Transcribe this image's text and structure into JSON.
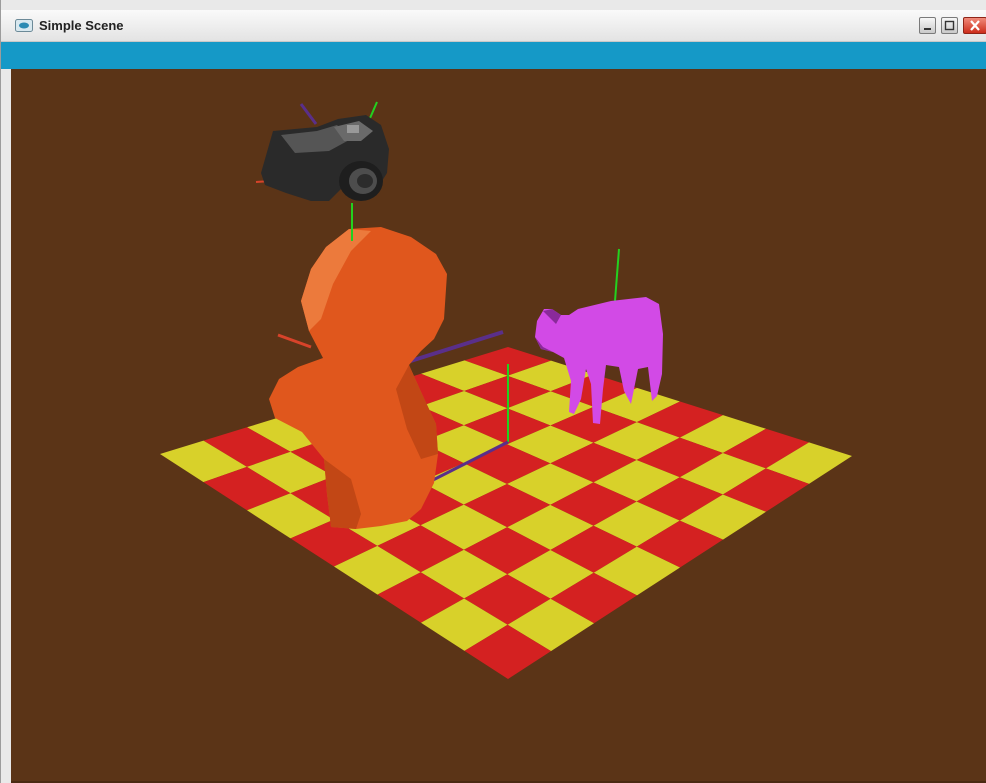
{
  "window": {
    "title": "Simple Scene",
    "minimize_icon": "minimize-icon",
    "maximize_icon": "maximize-icon",
    "close_icon": "close-icon"
  },
  "scene": {
    "background_color": "#5b3417",
    "toolbar_color": "#1599c7",
    "floor_colors": [
      "#d42121",
      "#d8d12a"
    ],
    "objects": [
      "camera",
      "bust",
      "cow"
    ],
    "object_colors": {
      "camera": "#2a2a2a",
      "bust": "#e0571d",
      "cow": "#d24ae6"
    }
  }
}
